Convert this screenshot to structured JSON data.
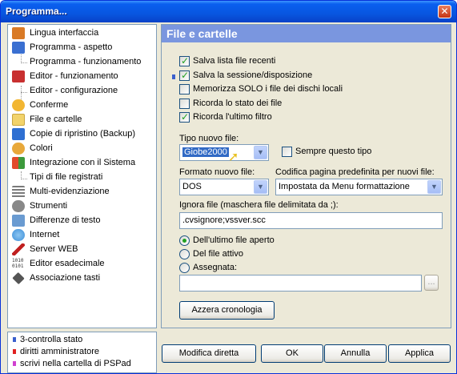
{
  "window": {
    "title": "Programma...",
    "close_label": "✕"
  },
  "tree": [
    {
      "label": "Lingua interfaccia",
      "icon": "people-icon",
      "color": "#D97A26"
    },
    {
      "label": "Programma - aspetto",
      "icon": "window-layout-icon",
      "color": "#3A6FD1"
    },
    {
      "label": "Programma - funzionamento",
      "icon": "",
      "color": ""
    },
    {
      "label": "Editor - funzionamento",
      "icon": "pencil-icon",
      "color": "#C83030"
    },
    {
      "label": "Editor - configurazione",
      "icon": "",
      "color": ""
    },
    {
      "label": "Conferme",
      "icon": "speech-bubble-icon",
      "color": "#F2B632"
    },
    {
      "label": "File e cartelle",
      "icon": "folder-icon",
      "color": "#F2D36B"
    },
    {
      "label": "Copie di ripristino (Backup)",
      "icon": "floppy-disk-icon",
      "color": "#2E6FD2"
    },
    {
      "label": "Colori",
      "icon": "palette-icon",
      "color": "#E8A83A"
    },
    {
      "label": "Integrazione con il Sistema",
      "icon": "windows-flag-icon",
      "color": "#3C9A3C"
    },
    {
      "label": "Tipi di file registrati",
      "icon": "",
      "color": ""
    },
    {
      "label": "Multi-evidenziazione",
      "icon": "list-icon",
      "color": "#7A7A7A"
    },
    {
      "label": "Strumenti",
      "icon": "gear-icon",
      "color": "#888888"
    },
    {
      "label": "Differenze di testo",
      "icon": "document-compare-icon",
      "color": "#6A9BD1"
    },
    {
      "label": "Internet",
      "icon": "globe-icon",
      "color": "#3E8FD8"
    },
    {
      "label": "Server WEB",
      "icon": "feather-icon",
      "color": "#C02020"
    },
    {
      "label": "Editor esadecimale",
      "icon": "binary-icon",
      "color": "#333333"
    },
    {
      "label": "Associazione tasti",
      "icon": "diamond-key-icon",
      "color": "#555555"
    }
  ],
  "legend": [
    {
      "label": "3-controlla stato",
      "color": "#3A5FCD"
    },
    {
      "label": "diritti amministratore",
      "color": "#E02020"
    },
    {
      "label": "scrivi nella cartella di PSPad",
      "color": "#D040D0"
    }
  ],
  "panel": {
    "header": "File e cartelle",
    "checkboxes": [
      {
        "label": "Salva lista file recenti",
        "checked": true
      },
      {
        "label": "Salva la sessione/disposizione",
        "checked": true
      },
      {
        "label": "Memorizza SOLO i file dei dischi locali",
        "checked": false
      },
      {
        "label": "Ricorda lo stato dei file",
        "checked": false
      },
      {
        "label": "Ricorda l'ultimo filtro",
        "checked": true
      }
    ],
    "new_file_type_label": "Tipo nuovo file:",
    "new_file_type_value": "Giobe2000",
    "always_this_type_label": "Sempre questo tipo",
    "always_this_type_checked": false,
    "file_format_label": "Formato nuovo file:",
    "file_format_value": "DOS",
    "codepage_label": "Codifica pagina predefinita per nuovi file:",
    "codepage_value": "Impostata da Menu formattazione",
    "ignore_label": "Ignora file (maschera file delimitata da ;):",
    "ignore_value": ".cvsignore;vssver.scc",
    "radios": [
      {
        "label": "Dell'ultimo file aperto",
        "checked": true
      },
      {
        "label": "Del file attivo",
        "checked": false
      },
      {
        "label": "Assegnata:",
        "checked": false
      }
    ],
    "assigned_value": "",
    "browse_label": "...",
    "clear_history_label": "Azzera cronologia"
  },
  "buttons": {
    "direct_edit": "Modifica diretta",
    "ok": "OK",
    "cancel": "Annulla",
    "apply": "Applica"
  },
  "colors": {
    "title_bar": "#0856E0",
    "panel_header": "#7A96DF",
    "selection": "#316AC5"
  }
}
